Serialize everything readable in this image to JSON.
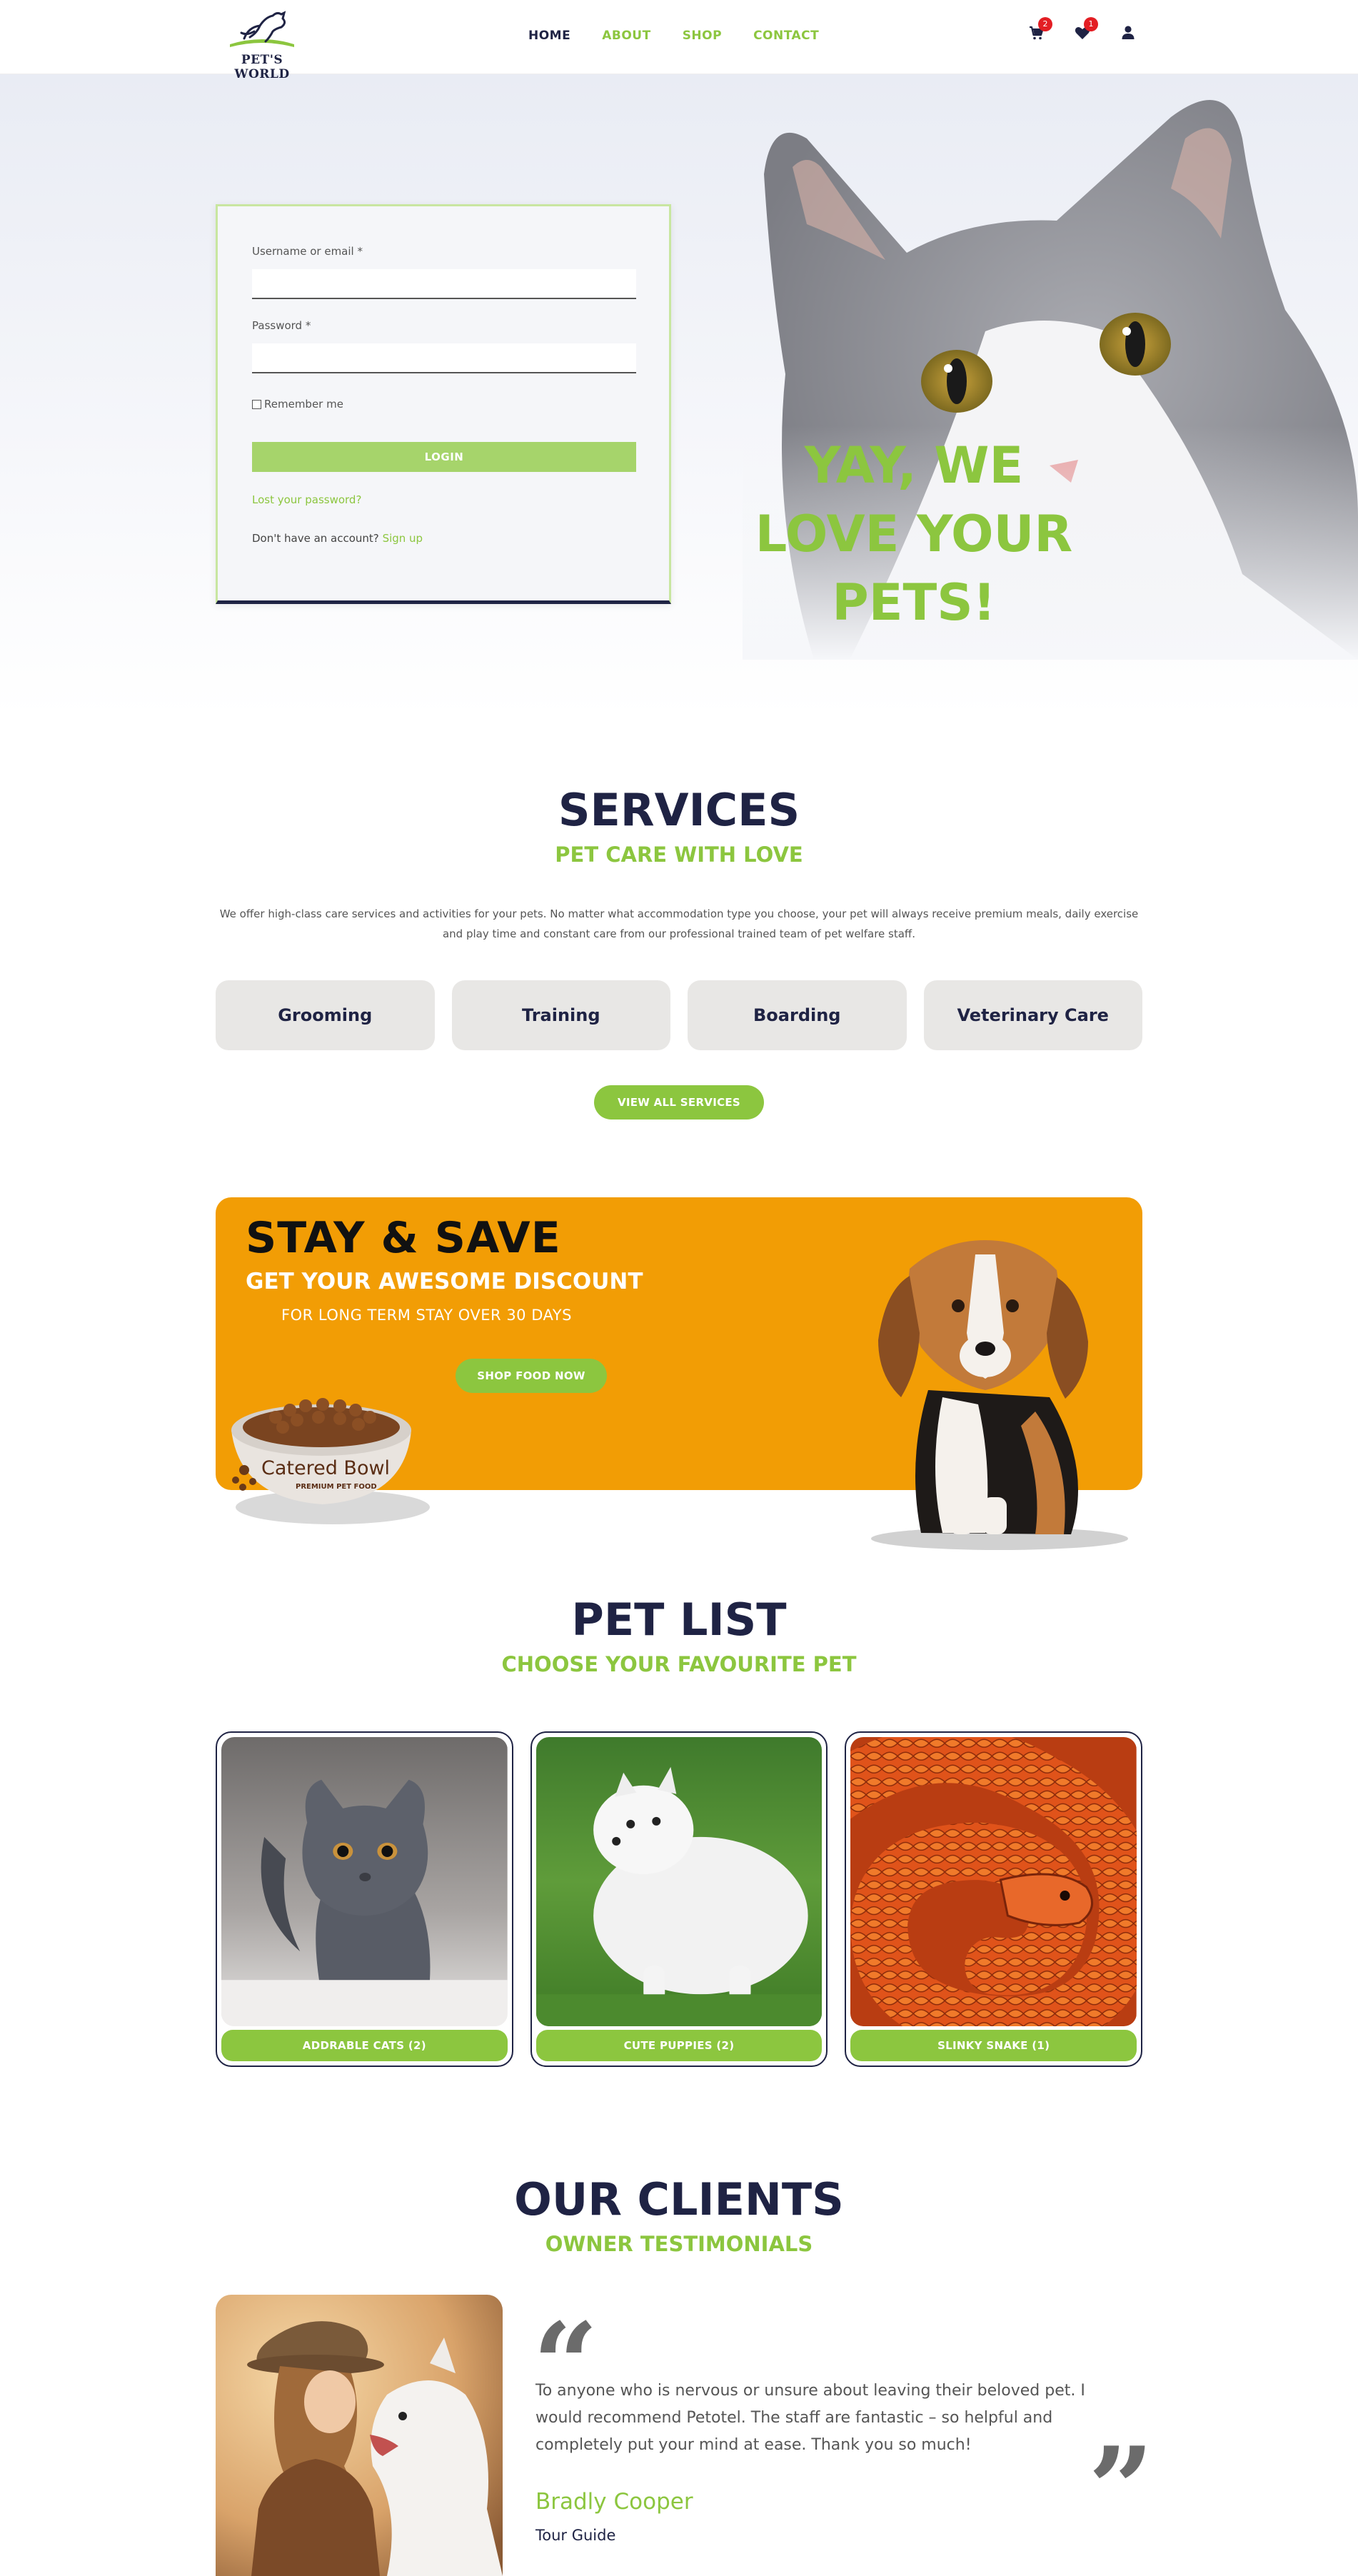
{
  "brand": {
    "logo_text": "PET'S WORLD"
  },
  "nav": {
    "items": [
      {
        "label": "HOME",
        "active": true
      },
      {
        "label": "ABOUT"
      },
      {
        "label": "SHOP"
      },
      {
        "label": "CONTACT"
      }
    ]
  },
  "header_icons": {
    "cart": {
      "icon": "cart-icon",
      "count": "2"
    },
    "wishlist": {
      "icon": "heart-icon",
      "count": "1"
    },
    "account": {
      "icon": "user-icon"
    }
  },
  "login": {
    "username_label": "Username or email *",
    "username_value": "",
    "password_label": "Password *",
    "password_value": "",
    "remember_label": "Remember me",
    "login_button": "LOGIN",
    "lost_password": "Lost your password?",
    "no_account": "Don't have an account?",
    "signup": "Sign up"
  },
  "hero": {
    "line1": "YAY, WE",
    "line2": "LOVE YOUR PETS!"
  },
  "services": {
    "title": "SERVICES",
    "subtitle": "PET CARE WITH LOVE",
    "description": "We offer high-class care services and activities for your pets. No matter what accommodation type you choose, your pet will always receive premium meals, daily exercise and play time and constant care from our professional trained team of pet welfare staff.",
    "items": [
      "Grooming",
      "Training",
      "Boarding",
      "Veterinary Care"
    ],
    "cta": "VIEW ALL SERVICES"
  },
  "promo": {
    "title": "STAY & SAVE",
    "subtitle": "GET YOUR AWESOME DISCOUNT",
    "note": "FOR LONG TERM STAY OVER 30 DAYS",
    "cta": "SHOP FOOD NOW",
    "bowl_brand": "Catered Bowl",
    "bowl_tagline": "PREMIUM PET FOOD"
  },
  "pets": {
    "title": "PET LIST",
    "subtitle": "CHOOSE YOUR FAVOURITE PET",
    "items": [
      {
        "label": "ADDRABLE CATS (2)"
      },
      {
        "label": "CUTE PUPPIES (2)"
      },
      {
        "label": "SLINKY SNAKE (1)"
      }
    ]
  },
  "clients": {
    "title": "OUR CLIENTS",
    "subtitle": "OWNER TESTIMONIALS",
    "quote": "To anyone who is nervous or unsure about leaving their beloved pet. I would recommend Petotel. The staff are fantastic – so helpful and completely put your mind at ease. Thank you so much!",
    "name": "Bradly Cooper",
    "role": "Tour Guide"
  },
  "colors": {
    "accent_green": "#8cc63f",
    "navy": "#1f2344",
    "promo_orange": "#f29d05",
    "badge_red": "#e31e24"
  }
}
